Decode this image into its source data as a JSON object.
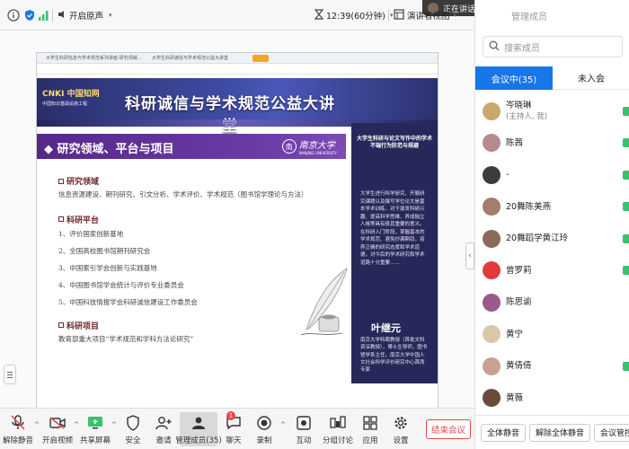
{
  "topbar": {
    "mute_status": "正在讲话: 陈茜",
    "denoise_label": "开启原声",
    "timer": "12:39(60分钟)",
    "speaker_view_label": "演讲者视图",
    "members_header_partial": "管理成员"
  },
  "slide": {
    "browser_tab_1": "大学生科研信息与学术规范系列讲座-研究领域...",
    "browser_tab_2": "大学生科研诚信与学术规范公益大讲堂",
    "logo_name": "CNKI 中国知网",
    "logo_sub": "中国知识基础设施工程",
    "title": "科研诚信与学术规范公益大讲堂",
    "section_header": "◆ 研究领域、平台与项目",
    "nju_name": "南京大学",
    "nju_sub": "NANJING UNIVERSITY",
    "research_title": "研究领域",
    "research_text": "信息资源建设、期刊研究、引文分析、学术评价、学术规范（图书馆学理论与方法）",
    "platform_title": "科研平台",
    "platform_items": [
      "1、评价国家创新基地",
      "2、全国高校图书馆期刊研究会",
      "3、中国索引学会创新与实践基地",
      "4、中国图书馆学会统计与评价专业委员会",
      "5、中国科技情报学会科研诚信建设工作委员会"
    ],
    "project_title": "科研项目",
    "project_text": "教育部重大项目“学术规范和学科方法论研究”",
    "side_head": "大学生科研与论文写作中的学术不端行为防范与规避",
    "side_desc": "大学生进行科学研究、开展研究课题以及撰写学位论文是基本学术训练，对于激发科研兴趣、提高科学思维、养成独立人格等具有极其重要的意义。在科研入门阶段，掌握基本的学术规范、避免抄袭剽窃，培养正确的研究态度和学术道德，对今后的学术研究和学术道路十分重要……",
    "side_name": "叶继元",
    "side_bio": "南京大学特聘教授（首批文科资深教授），博士生导师，图书馆学系主任，南京大学中国人文社会科学评价研究中心首席专家",
    "clock": "12:40",
    "date": "2022/6/28"
  },
  "members": {
    "title": "管理成员",
    "search_placeholder": "搜索成员",
    "tab_in_meeting": "会议中(35)",
    "tab_not_joined": "未入会",
    "list": [
      {
        "name": "岑晓琳",
        "role": "(主持人, 我)",
        "color": "#c9a86a"
      },
      {
        "name": "陈茜",
        "role": "",
        "color": "#b7898a"
      },
      {
        "name": "-",
        "role": "",
        "color": "#3c3c3c"
      },
      {
        "name": "20舞陈美燕",
        "role": "",
        "color": "#a67c6b"
      },
      {
        "name": "20舞蹈学黄江玲",
        "role": "",
        "color": "#8a6a5a"
      },
      {
        "name": "曾罗莉",
        "role": "",
        "color": "#e23a3a"
      },
      {
        "name": "陈思谕",
        "role": "",
        "color": "#9a5a8a"
      },
      {
        "name": "黄宁",
        "role": "",
        "color": "#d9c8a8"
      },
      {
        "name": "黄倩倩",
        "role": "",
        "color": "#caa090"
      },
      {
        "name": "黄薇",
        "role": "",
        "color": "#6a4a3a"
      }
    ],
    "btn_mute_all": "全体静音",
    "btn_unmute_all": "解除全体静音",
    "btn_settings": "会议管控"
  },
  "toolbar": {
    "mute": "解除静音",
    "video": "开启视频",
    "share": "共享屏幕",
    "security": "安全",
    "invite": "邀请",
    "manage_members": "管理成员(35)",
    "chat": "聊天",
    "chat_badge": "1",
    "record": "录制",
    "interact": "互动",
    "breakout": "分组讨论",
    "apps": "应用",
    "settings": "设置",
    "end": "结束会议"
  },
  "colors": {
    "accent": "#1976e8",
    "danger": "#e54848",
    "slide_purple": "#57288a",
    "slide_navy": "#27285a"
  }
}
